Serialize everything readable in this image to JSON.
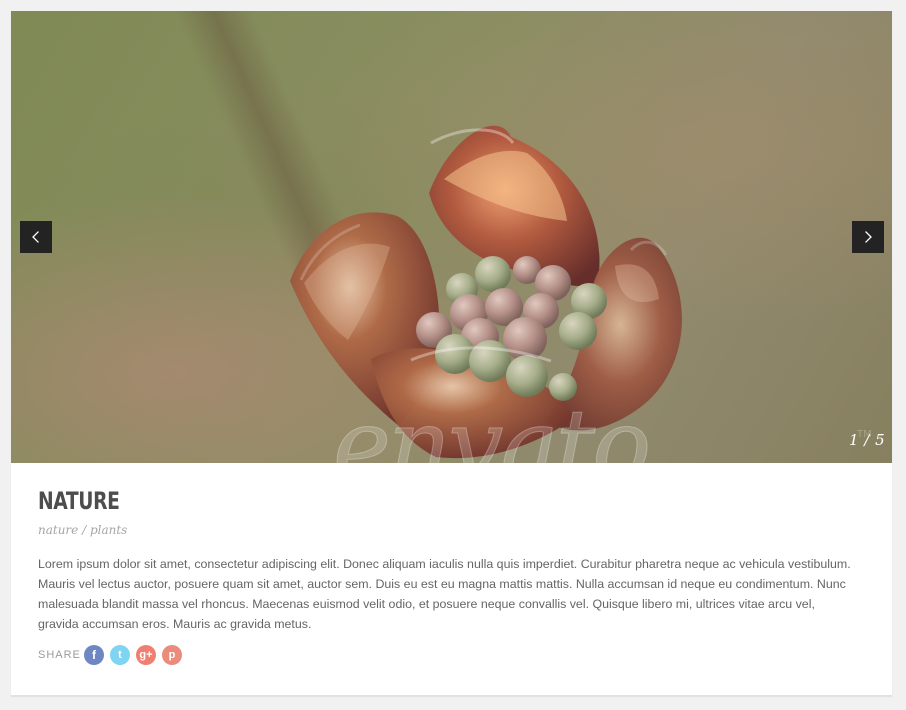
{
  "slider": {
    "counter": "1 / 5",
    "watermark_text": "envato",
    "watermark_mark": "TM"
  },
  "post": {
    "title": "NATURE",
    "subtitle": "nature / plants",
    "description": "Lorem ipsum dolor sit amet, consectetur adipiscing elit. Donec aliquam iaculis nulla quis imperdiet. Curabitur pharetra neque ac vehicula vestibulum. Mauris vel lectus auctor, posuere quam sit amet, auctor sem. Duis eu est eu magna mattis mattis. Nulla accumsan id neque eu condimentum.  Nunc malesuada blandit massa vel rhoncus. Maecenas euismod velit odio, et posuere neque convallis vel. Quisque libero mi, ultrices vitae arcu vel, gravida accumsan eros. Mauris ac gravida metus."
  },
  "share": {
    "label": "SHARE",
    "buttons": [
      {
        "name": "facebook",
        "glyph": "f",
        "color": "#6e86c2"
      },
      {
        "name": "twitter",
        "glyph": "t",
        "color": "#7fd4f2"
      },
      {
        "name": "google-plus",
        "glyph": "g+",
        "color": "#ef7f72"
      },
      {
        "name": "pinterest",
        "glyph": "p",
        "color": "#ea8b7c"
      }
    ]
  },
  "icons": {
    "previous": "chevron-left-icon",
    "next": "chevron-right-icon"
  },
  "colors": {
    "page_background": "#f1f1f1",
    "card_background": "#ffffff",
    "title_color": "#4d4d4d",
    "text_color": "#656565",
    "arrow_background": "#222322"
  }
}
